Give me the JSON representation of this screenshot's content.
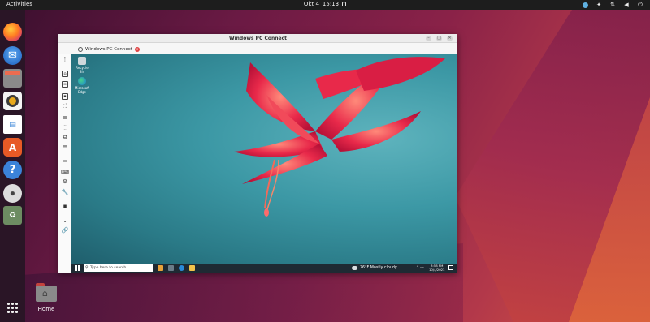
{
  "topbar": {
    "activities": "Activities",
    "date": "Okt 4",
    "time": "15:13",
    "right_icons": [
      "app-indicator-icon",
      "accessibility-icon",
      "network-icon",
      "volume-icon",
      "power-icon"
    ]
  },
  "dock": {
    "items": [
      "firefox-icon",
      "thunderbird-icon",
      "files-icon",
      "rhythmbox-icon",
      "libreoffice-writer-icon",
      "app-center-icon",
      "help-icon",
      "dvd-icon",
      "trash-icon"
    ]
  },
  "desktop": {
    "home_label": "Home"
  },
  "window": {
    "title": "Windows PC Connect",
    "tab_label": "Windows PC Connect"
  },
  "remote_desktop": {
    "icons": [
      "Recycle Bin",
      "Microsoft Edge"
    ],
    "taskbar": {
      "search_placeholder": "Type here to search",
      "weather": "76°F  Mostly cloudy",
      "time": "3:58 PM",
      "date": "10/4/2023"
    }
  },
  "colors": {
    "topbar": "#1d1d1d",
    "dock": "#2a1526",
    "remote_bg": "#3c98a5",
    "flower": "#e8294a",
    "taskbar": "#1e2a33"
  }
}
